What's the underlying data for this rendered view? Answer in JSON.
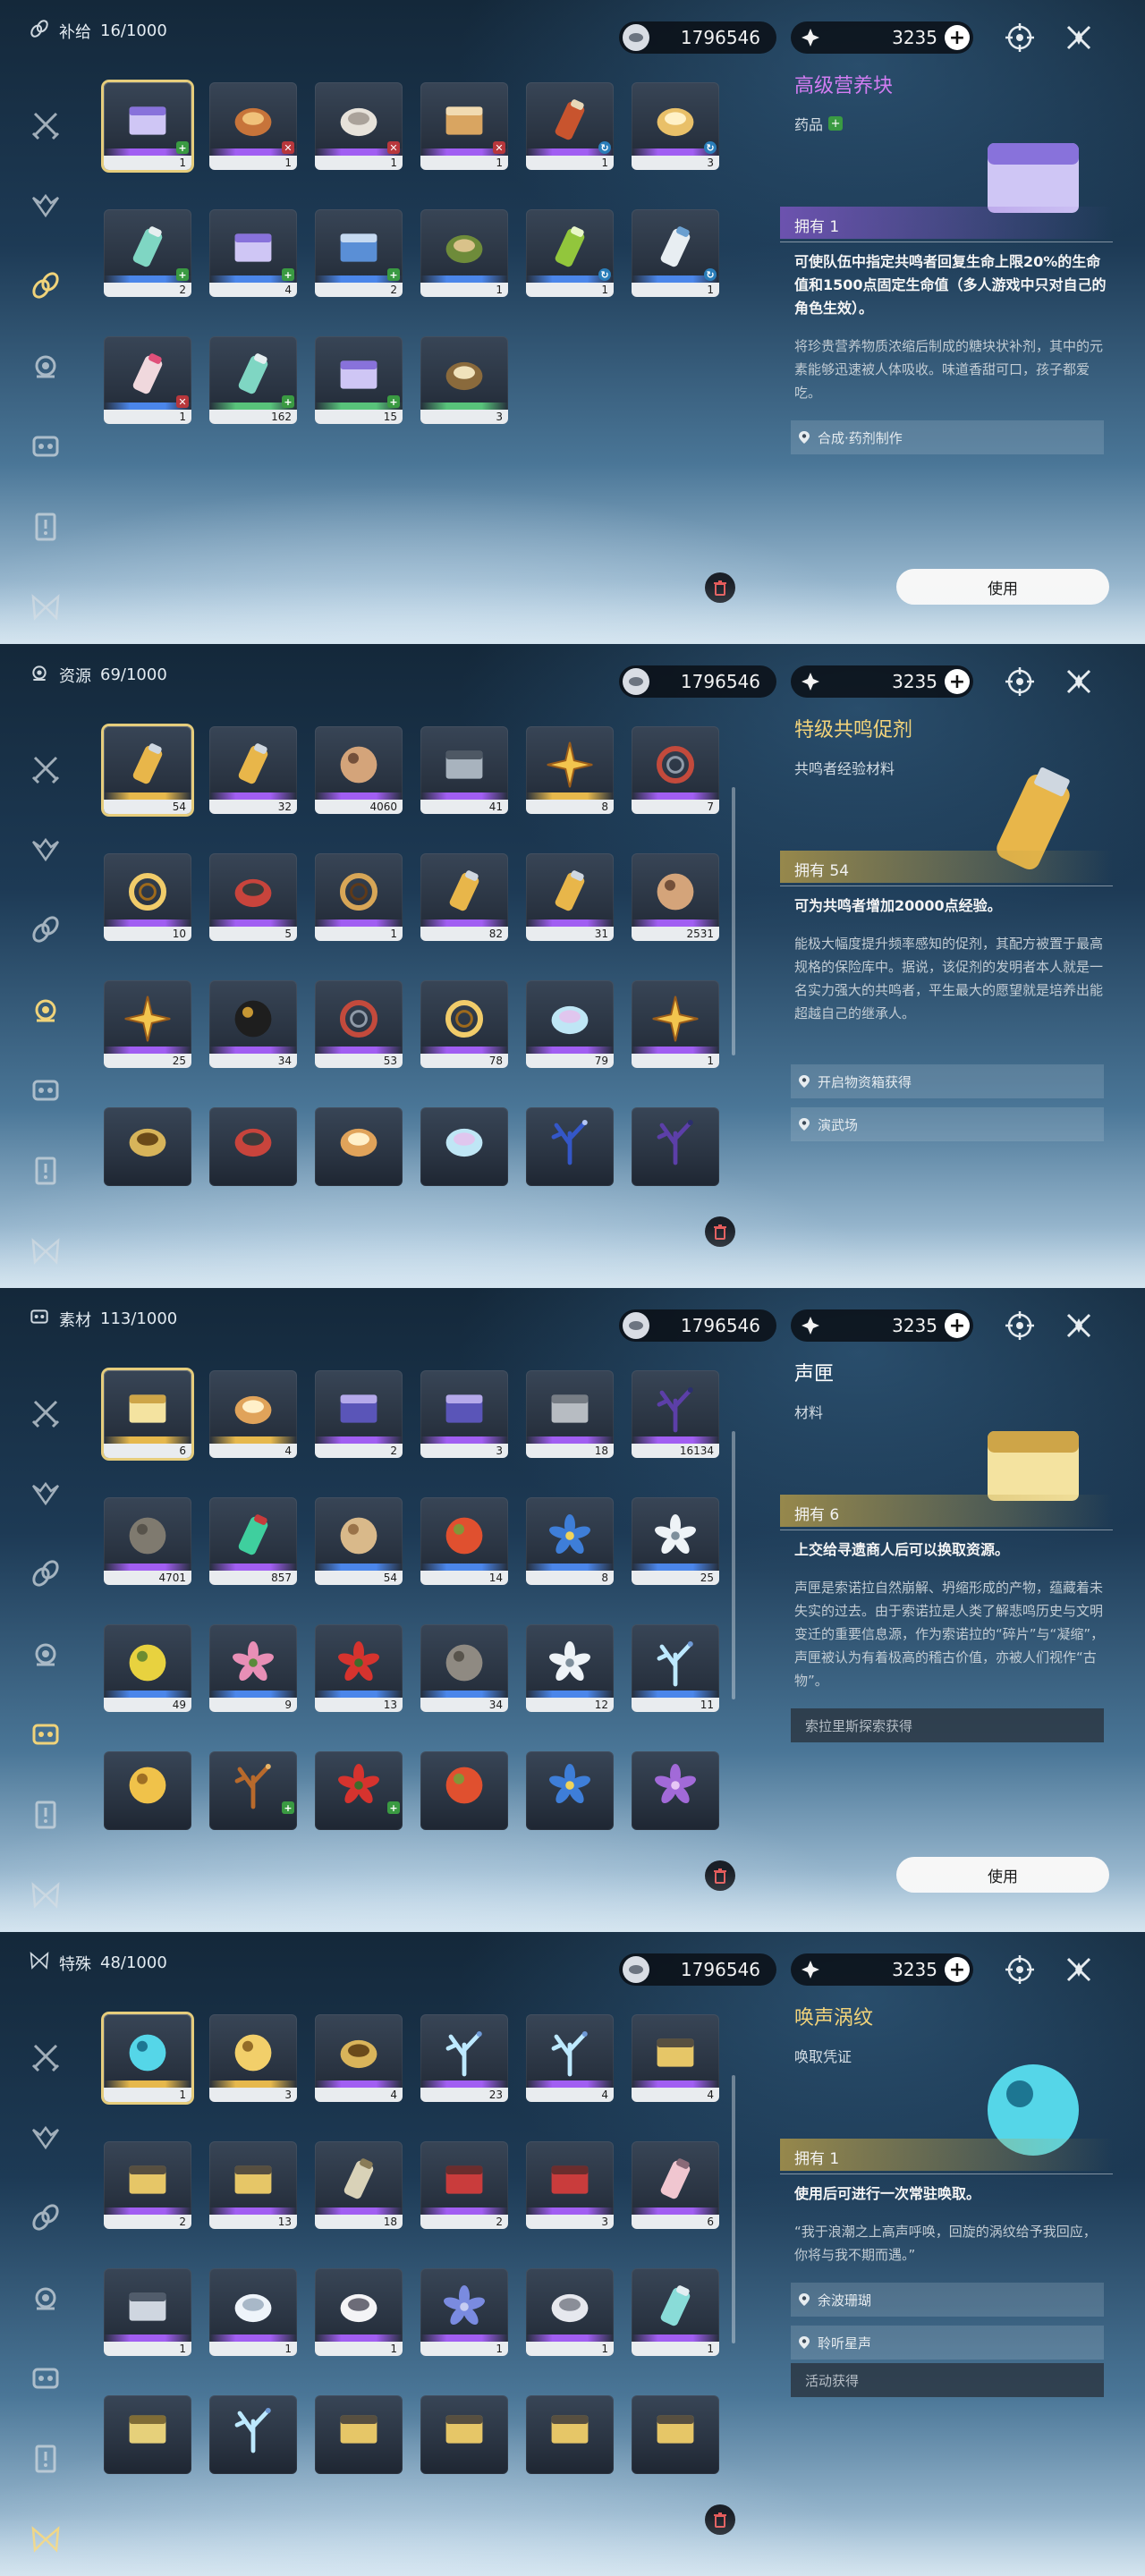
{
  "colors": {
    "selected_border": "#e6cd7c",
    "rarity_purple": "#a15ef2",
    "rarity_blue": "#4b86ea",
    "rarity_gold": "#e6b84c",
    "rarity_green": "#58c27a",
    "plus_badge": "#3a9a42",
    "x_badge": "#b8373c"
  },
  "currency": {
    "shell_credit": "1796546",
    "astrite": "3235"
  },
  "panels": [
    {
      "category": "补给",
      "count": "16/1000",
      "detail": {
        "name": "高级营养块",
        "type": "药品",
        "own": "拥有 1",
        "effect": "可使队伍中指定共鸣者回复生命上限20%的生命值和1500点固定生命值（多人游戏中只对自己的角色生效）。",
        "desc": "将珍贵营养物质浓缩后制成的糖块状补剂，其中的元素能够迅速被人体吸收。味道香甜可口，孩子都爱吃。",
        "sources": [
          "合成·药剂制作"
        ],
        "use_label": "使用"
      },
      "items": [
        {
          "count": "1",
          "rarity": "purple",
          "icon": "nutrient-block-icon",
          "badge": "plus"
        },
        {
          "count": "1",
          "rarity": "purple",
          "icon": "noodle-bowl-icon",
          "badge": "x"
        },
        {
          "count": "1",
          "rarity": "purple",
          "icon": "dumpling-icon",
          "badge": "x"
        },
        {
          "count": "1",
          "rarity": "purple",
          "icon": "bento-box-icon",
          "badge": "x"
        },
        {
          "count": "1",
          "rarity": "purple",
          "icon": "drink-can-icon",
          "badge": "cycle"
        },
        {
          "count": "3",
          "rarity": "purple",
          "icon": "crispy-snack-icon",
          "badge": "cycle"
        },
        {
          "count": "2",
          "rarity": "blue",
          "icon": "injector-icon",
          "badge": "plus"
        },
        {
          "count": "4",
          "rarity": "blue",
          "icon": "nutrient-block-icon",
          "badge": "plus"
        },
        {
          "count": "2",
          "rarity": "blue",
          "icon": "supply-pack-icon",
          "badge": "plus"
        },
        {
          "count": "1",
          "rarity": "blue",
          "icon": "skewer-plate-icon",
          "badge": ""
        },
        {
          "count": "1",
          "rarity": "blue",
          "icon": "juice-pouch-icon",
          "badge": "cycle"
        },
        {
          "count": "1",
          "rarity": "blue",
          "icon": "milk-carton-icon",
          "badge": "cycle"
        },
        {
          "count": "1",
          "rarity": "blue",
          "icon": "spray-bottle-icon",
          "badge": "x"
        },
        {
          "count": "162",
          "rarity": "green",
          "icon": "injector-icon",
          "badge": "plus"
        },
        {
          "count": "15",
          "rarity": "green",
          "icon": "nutrient-block-icon",
          "badge": "plus"
        },
        {
          "count": "3",
          "rarity": "green",
          "icon": "soup-bowl-icon",
          "badge": ""
        }
      ]
    },
    {
      "category": "资源",
      "count": "69/1000",
      "detail": {
        "name": "特级共鸣促剂",
        "type": "共鸣者经验材料",
        "own": "拥有 54",
        "effect": "可为共鸣者增加20000点经验。",
        "desc": "能极大幅度提升频率感知的促剂，其配方被置于最高规格的保险库中。据说，该促剂的发明者本人就是一名实力强大的共鸣者，平生最大的愿望就是培养出能超越自己的继承人。",
        "sources": [
          "开启物资箱获得",
          "演武场"
        ],
        "use_label": ""
      },
      "items": [
        {
          "count": "54",
          "rarity": "gold",
          "icon": "resonance-potion-icon",
          "badge": ""
        },
        {
          "count": "32",
          "rarity": "purple",
          "icon": "resonance-potion-icon",
          "badge": ""
        },
        {
          "count": "4060",
          "rarity": "purple",
          "icon": "energy-core-icon",
          "badge": ""
        },
        {
          "count": "41",
          "rarity": "purple",
          "icon": "device-chip-icon",
          "badge": ""
        },
        {
          "count": "8",
          "rarity": "gold",
          "icon": "star-crystal-icon",
          "badge": ""
        },
        {
          "count": "7",
          "rarity": "purple",
          "icon": "ring-band-icon",
          "badge": ""
        },
        {
          "count": "10",
          "rarity": "purple",
          "icon": "golden-web-icon",
          "badge": ""
        },
        {
          "count": "5",
          "rarity": "purple",
          "icon": "mech-part-icon",
          "badge": ""
        },
        {
          "count": "1",
          "rarity": "purple",
          "icon": "spiral-shell-icon",
          "badge": ""
        },
        {
          "count": "82",
          "rarity": "purple",
          "icon": "resonance-potion-icon",
          "badge": ""
        },
        {
          "count": "31",
          "rarity": "purple",
          "icon": "resonance-potion-icon",
          "badge": ""
        },
        {
          "count": "2531",
          "rarity": "purple",
          "icon": "energy-core-icon",
          "badge": ""
        },
        {
          "count": "25",
          "rarity": "purple",
          "icon": "star-crystal-icon",
          "badge": ""
        },
        {
          "count": "34",
          "rarity": "purple",
          "icon": "dark-orb-icon",
          "badge": ""
        },
        {
          "count": "53",
          "rarity": "purple",
          "icon": "ring-band-icon",
          "badge": ""
        },
        {
          "count": "78",
          "rarity": "purple",
          "icon": "golden-web-icon",
          "badge": ""
        },
        {
          "count": "79",
          "rarity": "purple",
          "icon": "crystal-shard-icon",
          "badge": ""
        },
        {
          "count": "1",
          "rarity": "purple",
          "icon": "star-crystal-icon",
          "badge": ""
        },
        {
          "count": "",
          "rarity": "",
          "icon": "pyramid-relic-icon",
          "badge": ""
        },
        {
          "count": "",
          "rarity": "",
          "icon": "mech-part-icon",
          "badge": ""
        },
        {
          "count": "",
          "rarity": "",
          "icon": "flame-seed-icon",
          "badge": ""
        },
        {
          "count": "",
          "rarity": "",
          "icon": "crystal-shard-icon",
          "badge": ""
        },
        {
          "count": "",
          "rarity": "",
          "icon": "feather-icon",
          "badge": ""
        },
        {
          "count": "",
          "rarity": "",
          "icon": "branch-icon",
          "badge": ""
        }
      ]
    },
    {
      "category": "素材",
      "count": "113/1000",
      "detail": {
        "name": "声匣",
        "type": "材料",
        "own": "拥有 6",
        "effect": "上交给寻遗商人后可以换取资源。",
        "desc": "声匣是索诺拉自然崩解、坍缩形成的产物，蕴藏着未失实的过去。由于索诺拉是人类了解悲鸣历史与文明变迁的重要信息源，作为索诺拉的“碎片”与“凝缩”，声匣被认为有着极高的稽古价值，亦被人们视作“古物”。",
        "sources": [
          "索拉里斯探索获得"
        ],
        "use_label": "使用"
      },
      "items": [
        {
          "count": "6",
          "rarity": "gold",
          "icon": "sound-box-icon",
          "badge": ""
        },
        {
          "count": "4",
          "rarity": "gold",
          "icon": "flame-seed-icon",
          "badge": ""
        },
        {
          "count": "2",
          "rarity": "purple",
          "icon": "data-card-icon",
          "badge": ""
        },
        {
          "count": "3",
          "rarity": "purple",
          "icon": "data-card-icon",
          "badge": ""
        },
        {
          "count": "18",
          "rarity": "purple",
          "icon": "metal-block-icon",
          "badge": ""
        },
        {
          "count": "16134",
          "rarity": "purple",
          "icon": "branch-icon",
          "badge": ""
        },
        {
          "count": "4701",
          "rarity": "purple",
          "icon": "stone-ball-icon",
          "badge": ""
        },
        {
          "count": "857",
          "rarity": "purple",
          "icon": "green-capsule-icon",
          "badge": ""
        },
        {
          "count": "54",
          "rarity": "blue",
          "icon": "bean-icon",
          "badge": ""
        },
        {
          "count": "14",
          "rarity": "blue",
          "icon": "red-fruit-icon",
          "badge": ""
        },
        {
          "count": "8",
          "rarity": "blue",
          "icon": "blue-flower-icon",
          "badge": ""
        },
        {
          "count": "25",
          "rarity": "blue",
          "icon": "white-flower-icon",
          "badge": ""
        },
        {
          "count": "49",
          "rarity": "blue",
          "icon": "lemon-icon",
          "badge": ""
        },
        {
          "count": "9",
          "rarity": "blue",
          "icon": "pink-lily-icon",
          "badge": ""
        },
        {
          "count": "13",
          "rarity": "blue",
          "icon": "red-flower-icon",
          "badge": ""
        },
        {
          "count": "34",
          "rarity": "blue",
          "icon": "mushroom-icon",
          "badge": ""
        },
        {
          "count": "12",
          "rarity": "blue",
          "icon": "white-flower-icon",
          "badge": ""
        },
        {
          "count": "11",
          "rarity": "blue",
          "icon": "coral-branch-icon",
          "badge": ""
        },
        {
          "count": "",
          "rarity": "",
          "icon": "golden-fruit-icon",
          "badge": ""
        },
        {
          "count": "",
          "rarity": "",
          "icon": "straw-icon",
          "badge": "plus"
        },
        {
          "count": "",
          "rarity": "",
          "icon": "red-flower-icon",
          "badge": "plus"
        },
        {
          "count": "",
          "rarity": "",
          "icon": "red-fruit-icon",
          "badge": ""
        },
        {
          "count": "",
          "rarity": "",
          "icon": "blue-flower-icon",
          "badge": ""
        },
        {
          "count": "",
          "rarity": "",
          "icon": "purple-flower-icon",
          "badge": ""
        }
      ]
    },
    {
      "category": "特殊",
      "count": "48/1000",
      "detail": {
        "name": "唤声涡纹",
        "type": "唤取凭证",
        "own": "拥有 1",
        "effect": "使用后可进行一次常驻唤取。",
        "desc": "“我于浪潮之上高声呼唤，回旋的涡纹给予我回应，你将与我不期而遇。”",
        "sources": [
          "余波珊瑚",
          "聆听星声"
        ],
        "extra_source": "活动获得",
        "use_label": ""
      },
      "items": [
        {
          "count": "1",
          "rarity": "gold",
          "icon": "lustrous-tide-icon",
          "badge": ""
        },
        {
          "count": "3",
          "rarity": "gold",
          "icon": "gold-coin-icon",
          "badge": ""
        },
        {
          "count": "4",
          "rarity": "purple",
          "icon": "key-icon",
          "badge": ""
        },
        {
          "count": "23",
          "rarity": "purple",
          "icon": "coral-branch-icon",
          "badge": ""
        },
        {
          "count": "4",
          "rarity": "purple",
          "icon": "coral-branch-icon",
          "badge": ""
        },
        {
          "count": "4",
          "rarity": "purple",
          "icon": "chest-icon",
          "badge": ""
        },
        {
          "count": "2",
          "rarity": "purple",
          "icon": "chest-icon",
          "badge": ""
        },
        {
          "count": "13",
          "rarity": "purple",
          "icon": "chest-icon",
          "badge": ""
        },
        {
          "count": "18",
          "rarity": "purple",
          "icon": "battery-icon",
          "badge": ""
        },
        {
          "count": "2",
          "rarity": "purple",
          "icon": "red-chest-icon",
          "badge": ""
        },
        {
          "count": "3",
          "rarity": "purple",
          "icon": "red-chest-icon",
          "badge": ""
        },
        {
          "count": "6",
          "rarity": "purple",
          "icon": "bottle-icon",
          "badge": ""
        },
        {
          "count": "1",
          "rarity": "purple",
          "icon": "photo-card-icon",
          "badge": ""
        },
        {
          "count": "1",
          "rarity": "purple",
          "icon": "paper-crane-icon",
          "badge": ""
        },
        {
          "count": "1",
          "rarity": "purple",
          "icon": "ghost-plush-icon",
          "badge": ""
        },
        {
          "count": "1",
          "rarity": "purple",
          "icon": "flower-bunch-icon",
          "badge": ""
        },
        {
          "count": "1",
          "rarity": "purple",
          "icon": "mask-icon",
          "badge": ""
        },
        {
          "count": "1",
          "rarity": "purple",
          "icon": "potion-vial-icon",
          "badge": ""
        },
        {
          "count": "",
          "rarity": "",
          "icon": "ticket-icon",
          "badge": ""
        },
        {
          "count": "",
          "rarity": "",
          "icon": "coral-branch-icon",
          "badge": ""
        },
        {
          "count": "",
          "rarity": "",
          "icon": "chest-icon",
          "badge": ""
        },
        {
          "count": "",
          "rarity": "",
          "icon": "chest-icon",
          "badge": ""
        },
        {
          "count": "",
          "rarity": "",
          "icon": "chest-icon",
          "badge": ""
        },
        {
          "count": "",
          "rarity": "",
          "icon": "chest-icon",
          "badge": ""
        }
      ]
    }
  ]
}
